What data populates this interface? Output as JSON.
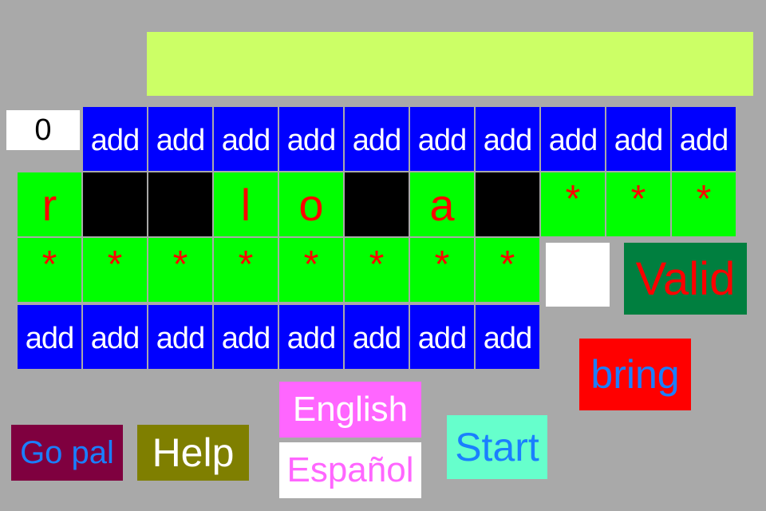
{
  "word_bar": {
    "text": ""
  },
  "score": {
    "value": "0"
  },
  "top_add_row": [
    "add",
    "add",
    "add",
    "add",
    "add",
    "add",
    "add",
    "add",
    "add",
    "add"
  ],
  "word_cells": [
    {
      "letter": "r",
      "hidden": false
    },
    {
      "letter": "",
      "hidden": true
    },
    {
      "letter": "",
      "hidden": true
    },
    {
      "letter": "l",
      "hidden": false
    },
    {
      "letter": "o",
      "hidden": false
    },
    {
      "letter": "",
      "hidden": true
    },
    {
      "letter": "a",
      "hidden": false
    },
    {
      "letter": "",
      "hidden": true
    },
    {
      "letter": "*",
      "hidden": false
    },
    {
      "letter": "*",
      "hidden": false
    },
    {
      "letter": "*",
      "hidden": false
    }
  ],
  "star_row": [
    "*",
    "*",
    "*",
    "*",
    "*",
    "*",
    "*",
    "*"
  ],
  "bottom_add_row": [
    "add",
    "add",
    "add",
    "add",
    "add",
    "add",
    "add",
    "add"
  ],
  "buttons": {
    "valid": "Valid",
    "bring": "bring",
    "go_pal": "Go pal",
    "help": "Help",
    "english": "English",
    "espanol": "Español",
    "start": "Start"
  },
  "colors": {
    "background": "#a9a9a9",
    "word_bar": "#ccff66",
    "add": "#0000ff",
    "letter_tile": "#00ff00",
    "letter_text": "#ff0000",
    "hidden_tile": "#000000",
    "valid_bg": "#007f3f",
    "bring_bg": "#ff0000",
    "go_pal_bg": "#7f003f",
    "help_bg": "#7f7f00",
    "english_bg": "#ff66ff",
    "start_bg": "#66ffcc",
    "link_blue": "#1a7fff"
  }
}
